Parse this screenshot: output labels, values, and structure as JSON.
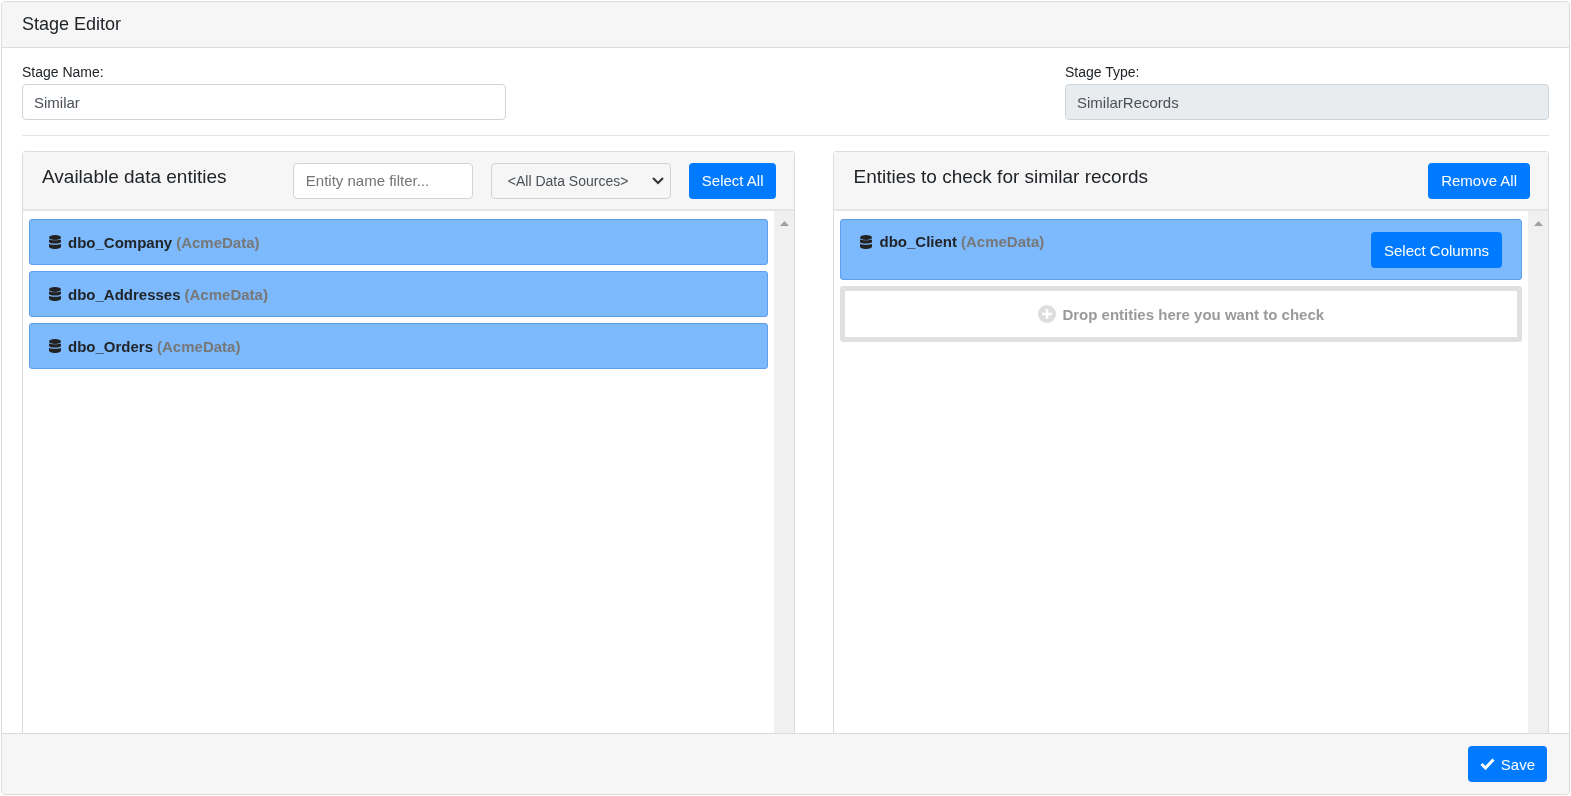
{
  "window": {
    "title": "Stage Editor"
  },
  "stage_name": {
    "label": "Stage Name:",
    "value": "Similar"
  },
  "stage_type": {
    "label": "Stage Type:",
    "value": "SimilarRecords"
  },
  "available": {
    "title": "Available data entities",
    "filter": {
      "placeholder": "Entity name filter..."
    },
    "source_select": {
      "value": "<All Data Sources>"
    },
    "button": "Select All",
    "entities": [
      {
        "name": "dbo_Company",
        "source": "(AcmeData)"
      },
      {
        "name": "dbo_Addresses",
        "source": "(AcmeData)"
      },
      {
        "name": "dbo_Orders",
        "source": "(AcmeData)"
      }
    ]
  },
  "checked": {
    "title": "Entities to check for similar records",
    "button": "Remove All",
    "entities": [
      {
        "name": "dbo_Client",
        "source": "(AcmeData)",
        "button": "Select Columns"
      }
    ],
    "drop_zone": "Drop entities here you want to check"
  },
  "footer": {
    "save_button": "Save"
  }
}
